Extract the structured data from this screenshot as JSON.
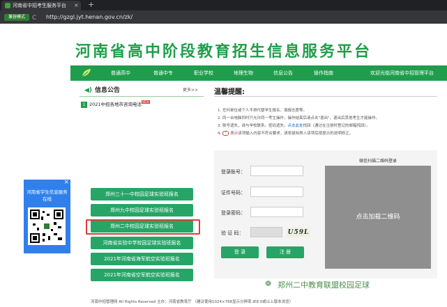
{
  "browser": {
    "tab_title": "河南省中招考生服务平台",
    "tab_close": "×",
    "new_tab": "+",
    "nav_back": "←",
    "nav_forward": "→",
    "nav_reload": "C",
    "secure_label": "兼容模式",
    "url": "http://gzgl.jyt.henan.gov.cn/zk/"
  },
  "site_title": "河南省高中阶段教育招生信息服务平台",
  "navbar": {
    "items": [
      "普通高中",
      "普通中专",
      "职业学校",
      "地理生物",
      "信息公告",
      "操作指南"
    ],
    "welcome": "欢迎光临河南省中招管理平台"
  },
  "announcements": {
    "heading": "信息公告",
    "more": "更多>>",
    "items": [
      {
        "num": "1",
        "text": "2021中招各地市咨询电话",
        "badge": "NEW"
      }
    ]
  },
  "tips": {
    "heading": "温馨提醒:",
    "lines": [
      {
        "pre": "1. 任何单位或个人不得代替学生报名、填报志愿等。",
        "hl": "",
        "post": ""
      },
      {
        "pre": "2. 同一台电脑同时只允许同一考生操作，操作结束后请点击\"退出\"，退出后其他考生才能操作。",
        "hl": "",
        "post": ""
      },
      {
        "pre": "3. 账号遗失，请与学校联系。密码遗失，",
        "hl": "点击此处",
        "post": "找回（通过在注册时登记的邮箱找回）。"
      },
      {
        "pre": "4.",
        "hl": "",
        "post": "表示该项输入内容不符合要求，请将鼠标移入该项后按提示的说明修正。"
      }
    ],
    "warn_glyph": "!"
  },
  "float_widget": {
    "close": "×",
    "text": "河南省学生信息服务在线"
  },
  "registration_buttons": [
    "郑州三十一中校园足球实验班报名",
    "郑州九中校园足球实验班报名",
    "郑州二中校园足球实验班报名",
    "河南省实验中学校园足球实验班报名",
    "2021年河南省海军航空实验班报名",
    "2021年河南省空军航空实验班报名"
  ],
  "login": {
    "account_label": "登录账号：",
    "idnum_label": "证件号码：",
    "password_label": "登录密码：",
    "captcha_label": "验 证 码：",
    "captcha_text": "U59L",
    "login_button": "登 录",
    "register_button": "注 册"
  },
  "qr_login": {
    "title": "微信扫描二维码登录",
    "placeholder": "点击加载二维码"
  },
  "footer": {
    "text": "河南中招管理网 All Rights Reserved 主办：河南省教育厅 （建议使用1024×768显示分辨率,IE8.0或以上版本浏览）"
  },
  "watermark": "郑州二中教育联盟校园足球",
  "colors": {
    "brand_green": "#1f9d4c",
    "button_green": "#26a567",
    "highlight_red": "#e53935",
    "widget_blue": "#2f80ed"
  }
}
